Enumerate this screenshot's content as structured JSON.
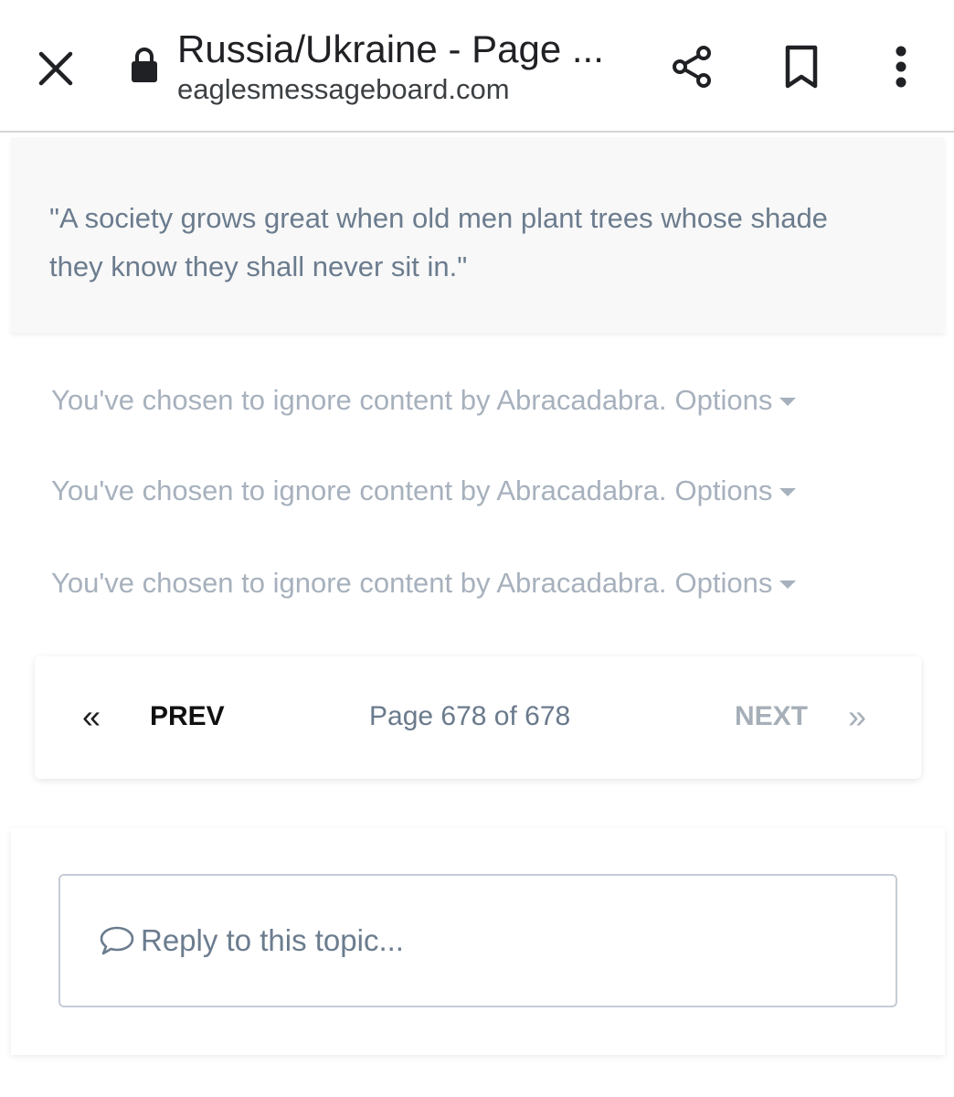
{
  "browser": {
    "title": "Russia/Ukraine - Page ...",
    "url": "eaglesmessageboard.com",
    "icons": [
      "close-icon",
      "lock-icon",
      "share-icon",
      "bookmark-icon",
      "more-vert-icon"
    ]
  },
  "quote": {
    "text": "\"A society grows great when old men plant trees whose shade they know they shall never sit in.\""
  },
  "ignored_posts": [
    {
      "message": "You've chosen to ignore content by Abracadabra.",
      "options_label": "Options"
    },
    {
      "message": "You've chosen to ignore content by Abracadabra.",
      "options_label": "Options"
    },
    {
      "message": "You've chosen to ignore content by Abracadabra.",
      "options_label": "Options"
    }
  ],
  "pagination": {
    "first_symbol": "«",
    "prev_label": "PREV",
    "page_info": "Page 678 of 678",
    "next_label": "NEXT",
    "last_symbol": "»"
  },
  "reply": {
    "placeholder": "Reply to this topic..."
  },
  "colors": {
    "quote_bg": "#f8f8f8",
    "muted_text": "#a7b1bd",
    "slate_text": "#6b7c8e"
  }
}
